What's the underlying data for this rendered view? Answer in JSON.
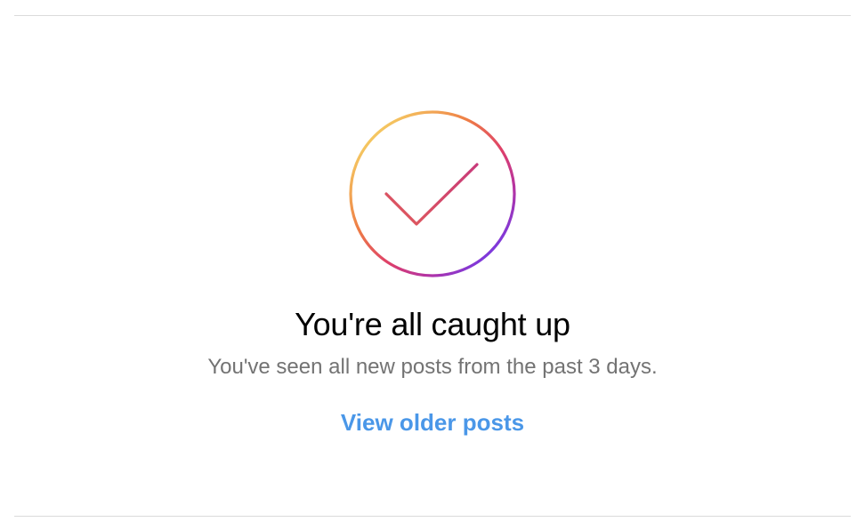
{
  "feed_end": {
    "icon": "check-circle-gradient-icon",
    "headline": "You're all caught up",
    "subtext": "You've seen all new posts from the past 3 days.",
    "link_label": "View older posts"
  },
  "colors": {
    "headline": "#000000",
    "subtext": "#737373",
    "link": "#4a97e8",
    "divider": "#dbdbdb",
    "gradient": [
      "#f9d462",
      "#f08a3a",
      "#e0405f",
      "#c2338f",
      "#7a38e8"
    ]
  }
}
